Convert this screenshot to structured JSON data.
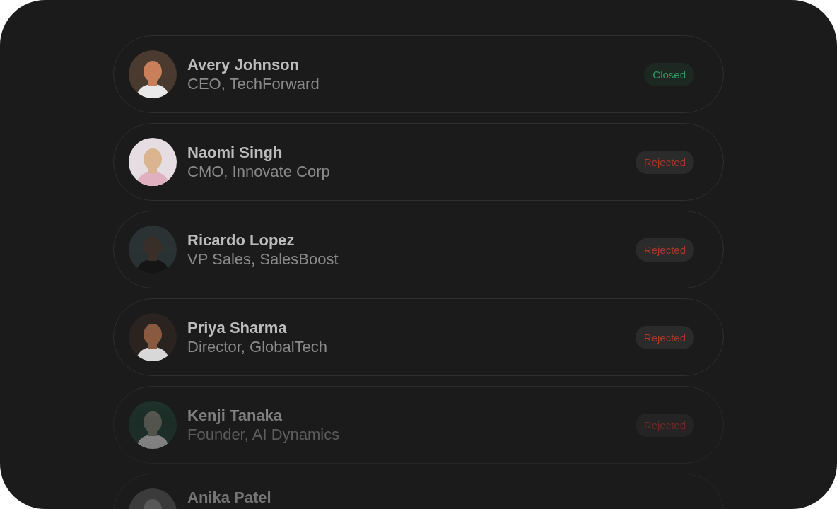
{
  "contacts": [
    {
      "name": "Avery Johnson",
      "role": "CEO, TechForward",
      "status": {
        "label": "Closed",
        "kind": "closed"
      }
    },
    {
      "name": "Naomi Singh",
      "role": "CMO, Innovate Corp",
      "status": {
        "label": "Rejected",
        "kind": "rejected"
      }
    },
    {
      "name": "Ricardo Lopez",
      "role": "VP Sales, SalesBoost",
      "status": {
        "label": "Rejected",
        "kind": "rejected"
      }
    },
    {
      "name": "Priya Sharma",
      "role": "Director, GlobalTech",
      "status": {
        "label": "Rejected",
        "kind": "rejected"
      }
    },
    {
      "name": "Kenji Tanaka",
      "role": "Founder, AI Dynamics",
      "status": {
        "label": "Rejected",
        "kind": "rejected"
      }
    },
    {
      "name": "Anika Patel"
    }
  ]
}
